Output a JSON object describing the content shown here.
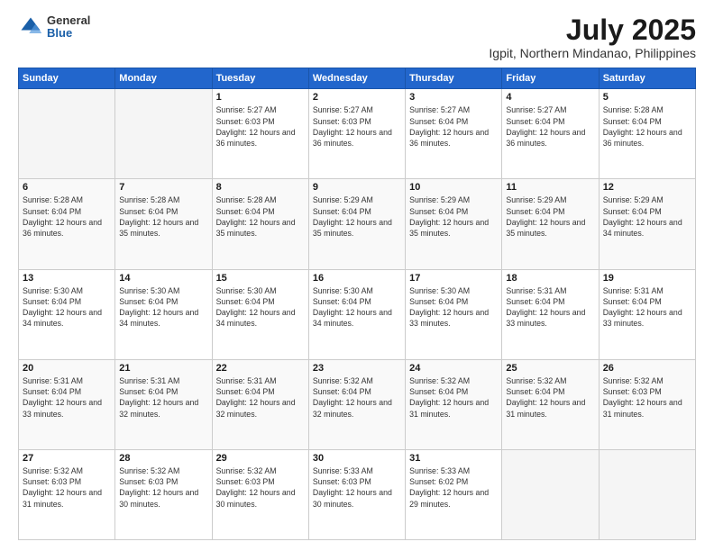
{
  "logo": {
    "general": "General",
    "blue": "Blue"
  },
  "header": {
    "title": "July 2025",
    "subtitle": "Igpit, Northern Mindanao, Philippines"
  },
  "weekdays": [
    "Sunday",
    "Monday",
    "Tuesday",
    "Wednesday",
    "Thursday",
    "Friday",
    "Saturday"
  ],
  "weeks": [
    [
      {
        "day": "",
        "info": ""
      },
      {
        "day": "",
        "info": ""
      },
      {
        "day": "1",
        "info": "Sunrise: 5:27 AM\nSunset: 6:03 PM\nDaylight: 12 hours and 36 minutes."
      },
      {
        "day": "2",
        "info": "Sunrise: 5:27 AM\nSunset: 6:03 PM\nDaylight: 12 hours and 36 minutes."
      },
      {
        "day": "3",
        "info": "Sunrise: 5:27 AM\nSunset: 6:04 PM\nDaylight: 12 hours and 36 minutes."
      },
      {
        "day": "4",
        "info": "Sunrise: 5:27 AM\nSunset: 6:04 PM\nDaylight: 12 hours and 36 minutes."
      },
      {
        "day": "5",
        "info": "Sunrise: 5:28 AM\nSunset: 6:04 PM\nDaylight: 12 hours and 36 minutes."
      }
    ],
    [
      {
        "day": "6",
        "info": "Sunrise: 5:28 AM\nSunset: 6:04 PM\nDaylight: 12 hours and 36 minutes."
      },
      {
        "day": "7",
        "info": "Sunrise: 5:28 AM\nSunset: 6:04 PM\nDaylight: 12 hours and 35 minutes."
      },
      {
        "day": "8",
        "info": "Sunrise: 5:28 AM\nSunset: 6:04 PM\nDaylight: 12 hours and 35 minutes."
      },
      {
        "day": "9",
        "info": "Sunrise: 5:29 AM\nSunset: 6:04 PM\nDaylight: 12 hours and 35 minutes."
      },
      {
        "day": "10",
        "info": "Sunrise: 5:29 AM\nSunset: 6:04 PM\nDaylight: 12 hours and 35 minutes."
      },
      {
        "day": "11",
        "info": "Sunrise: 5:29 AM\nSunset: 6:04 PM\nDaylight: 12 hours and 35 minutes."
      },
      {
        "day": "12",
        "info": "Sunrise: 5:29 AM\nSunset: 6:04 PM\nDaylight: 12 hours and 34 minutes."
      }
    ],
    [
      {
        "day": "13",
        "info": "Sunrise: 5:30 AM\nSunset: 6:04 PM\nDaylight: 12 hours and 34 minutes."
      },
      {
        "day": "14",
        "info": "Sunrise: 5:30 AM\nSunset: 6:04 PM\nDaylight: 12 hours and 34 minutes."
      },
      {
        "day": "15",
        "info": "Sunrise: 5:30 AM\nSunset: 6:04 PM\nDaylight: 12 hours and 34 minutes."
      },
      {
        "day": "16",
        "info": "Sunrise: 5:30 AM\nSunset: 6:04 PM\nDaylight: 12 hours and 34 minutes."
      },
      {
        "day": "17",
        "info": "Sunrise: 5:30 AM\nSunset: 6:04 PM\nDaylight: 12 hours and 33 minutes."
      },
      {
        "day": "18",
        "info": "Sunrise: 5:31 AM\nSunset: 6:04 PM\nDaylight: 12 hours and 33 minutes."
      },
      {
        "day": "19",
        "info": "Sunrise: 5:31 AM\nSunset: 6:04 PM\nDaylight: 12 hours and 33 minutes."
      }
    ],
    [
      {
        "day": "20",
        "info": "Sunrise: 5:31 AM\nSunset: 6:04 PM\nDaylight: 12 hours and 33 minutes."
      },
      {
        "day": "21",
        "info": "Sunrise: 5:31 AM\nSunset: 6:04 PM\nDaylight: 12 hours and 32 minutes."
      },
      {
        "day": "22",
        "info": "Sunrise: 5:31 AM\nSunset: 6:04 PM\nDaylight: 12 hours and 32 minutes."
      },
      {
        "day": "23",
        "info": "Sunrise: 5:32 AM\nSunset: 6:04 PM\nDaylight: 12 hours and 32 minutes."
      },
      {
        "day": "24",
        "info": "Sunrise: 5:32 AM\nSunset: 6:04 PM\nDaylight: 12 hours and 31 minutes."
      },
      {
        "day": "25",
        "info": "Sunrise: 5:32 AM\nSunset: 6:04 PM\nDaylight: 12 hours and 31 minutes."
      },
      {
        "day": "26",
        "info": "Sunrise: 5:32 AM\nSunset: 6:03 PM\nDaylight: 12 hours and 31 minutes."
      }
    ],
    [
      {
        "day": "27",
        "info": "Sunrise: 5:32 AM\nSunset: 6:03 PM\nDaylight: 12 hours and 31 minutes."
      },
      {
        "day": "28",
        "info": "Sunrise: 5:32 AM\nSunset: 6:03 PM\nDaylight: 12 hours and 30 minutes."
      },
      {
        "day": "29",
        "info": "Sunrise: 5:32 AM\nSunset: 6:03 PM\nDaylight: 12 hours and 30 minutes."
      },
      {
        "day": "30",
        "info": "Sunrise: 5:33 AM\nSunset: 6:03 PM\nDaylight: 12 hours and 30 minutes."
      },
      {
        "day": "31",
        "info": "Sunrise: 5:33 AM\nSunset: 6:02 PM\nDaylight: 12 hours and 29 minutes."
      },
      {
        "day": "",
        "info": ""
      },
      {
        "day": "",
        "info": ""
      }
    ]
  ]
}
